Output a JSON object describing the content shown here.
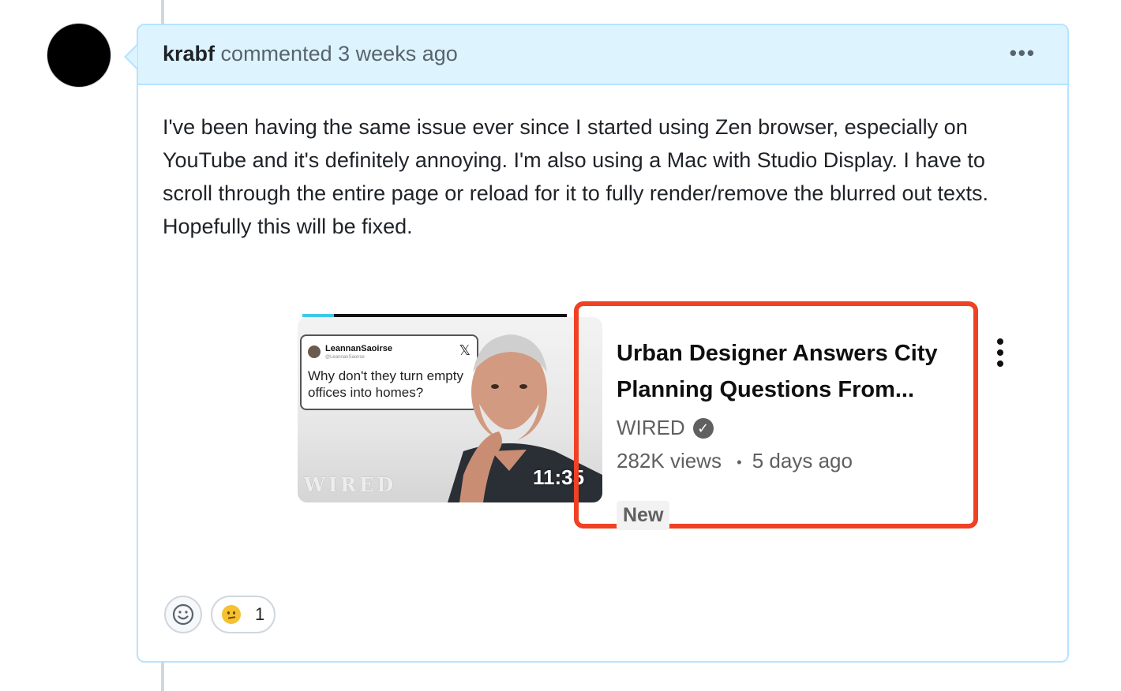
{
  "comment": {
    "author": "krabf",
    "action": "commented",
    "time": "3 weeks ago",
    "more_label": "•••",
    "body": "I've been having the same issue ever since I started using Zen browser, especially on YouTube and it's definitely annoying. I'm also using a Mac with Studio Display. I have to scroll through the entire page or reload for it to fully render/remove the blurred out texts. Hopefully this will be fixed."
  },
  "embedded_video": {
    "tweet_user": "LeannanSaoirse",
    "tweet_handle": "@LeannanSaoirse",
    "tweet_x": "𝕏",
    "tweet_text": "Why don't they turn empty offices into homes?",
    "thumbnail_logo": "WIRED",
    "duration": "11:35",
    "title": "Urban Designer Answers City Planning Questions From...",
    "channel": "WIRED",
    "verified_glyph": "✓",
    "views": "282K views",
    "separator": "•",
    "age": "5 days ago",
    "badge": "New",
    "highlight_color": "#ef4123"
  },
  "reactions": {
    "add_icon": "smiley-icon",
    "items": [
      {
        "emoji": "confused-face",
        "count": "1"
      }
    ]
  }
}
